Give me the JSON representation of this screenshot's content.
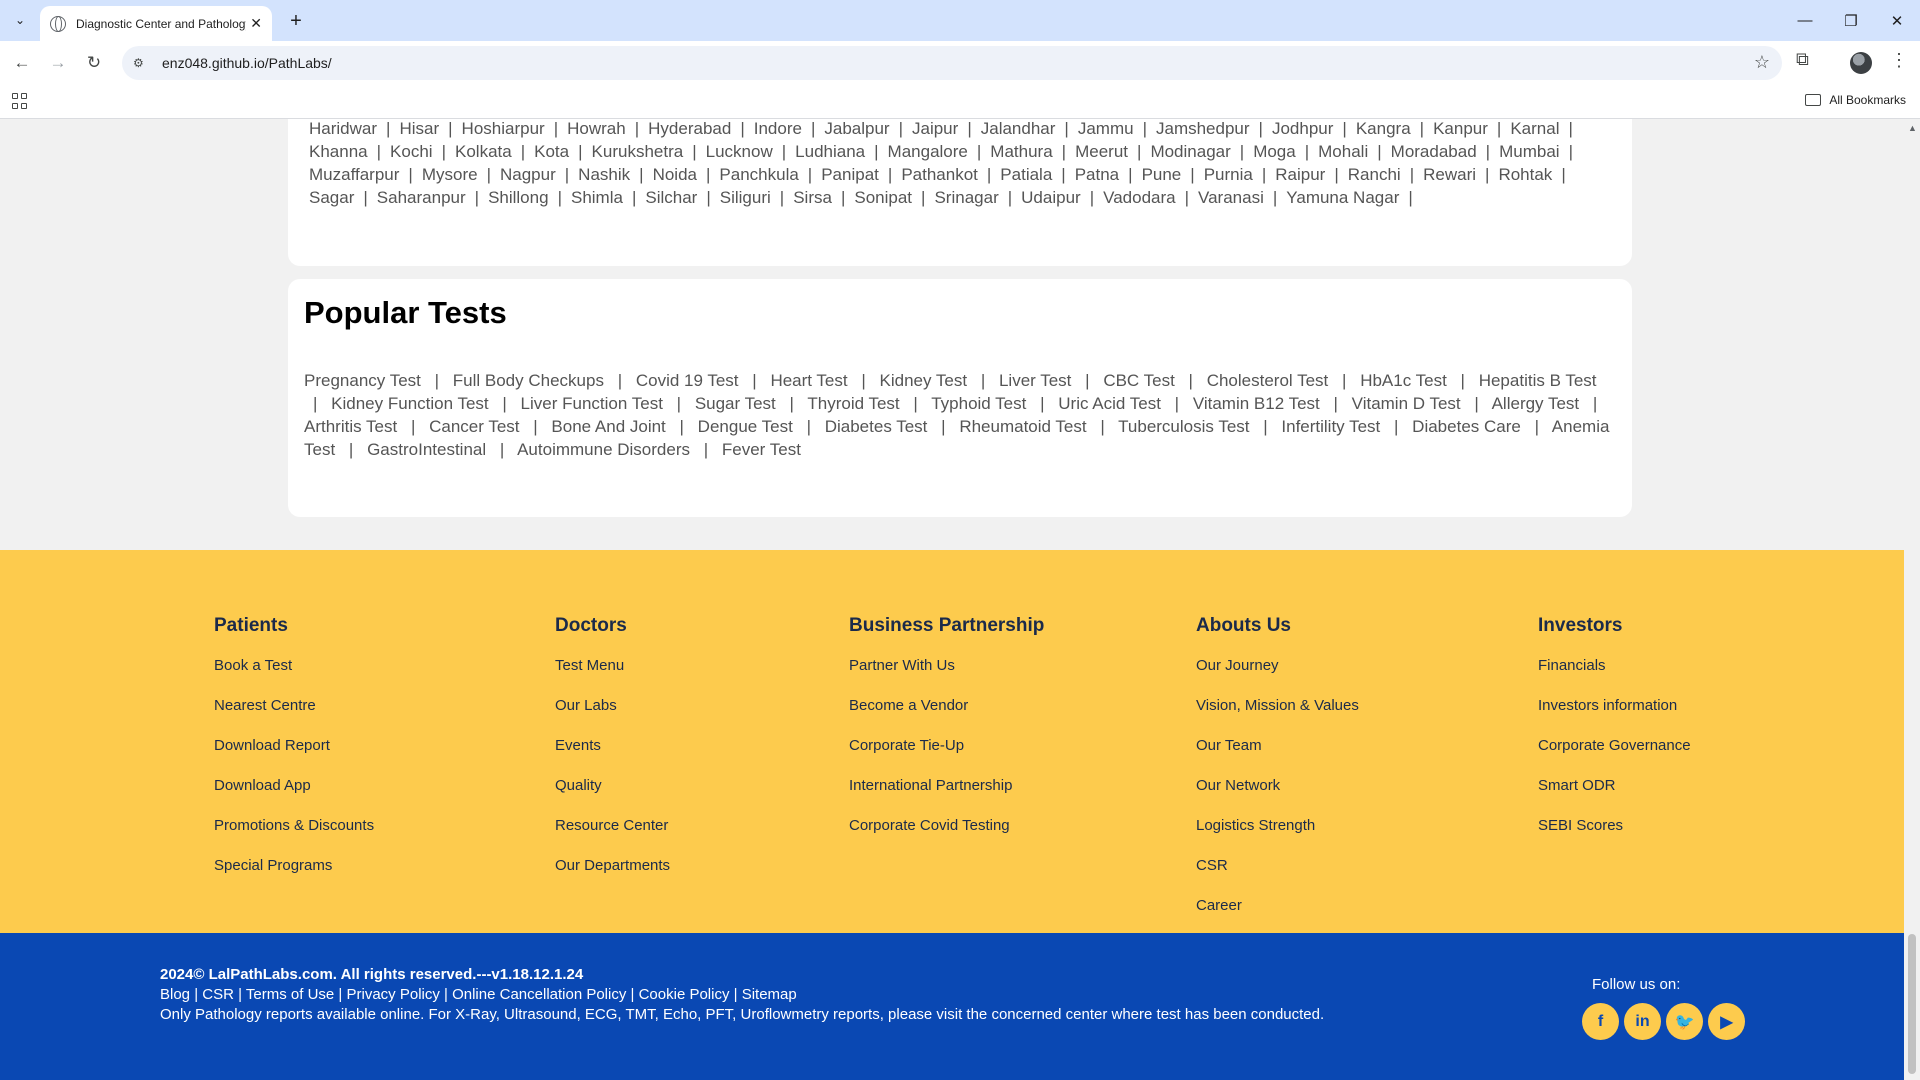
{
  "browser": {
    "tab_title": "Diagnostic Center and Pathology Lab",
    "url": "enz048.github.io/PathLabs/",
    "all_bookmarks": "All Bookmarks"
  },
  "cities": {
    "rows": [
      [
        "Haridwar",
        "Hisar",
        "Hoshiarpur",
        "Howrah",
        "Hyderabad",
        "Indore",
        "Jabalpur",
        "Jaipur",
        "Jalandhar",
        "Jammu",
        "Jamshedpur",
        "Jodhpur",
        "Kangra",
        "Kanpur",
        "Karnal"
      ],
      [
        "Khanna",
        "Kochi",
        "Kolkata",
        "Kota",
        "Kurukshetra",
        "Lucknow",
        "Ludhiana",
        "Mangalore",
        "Mathura",
        "Meerut",
        "Modinagar",
        "Moga",
        "Mohali",
        "Moradabad",
        "Mumbai"
      ],
      [
        "Muzaffarpur",
        "Mysore",
        "Nagpur",
        "Nashik",
        "Noida",
        "Panchkula",
        "Panipat",
        "Pathankot",
        "Patiala",
        "Patna",
        "Pune",
        "Purnia",
        "Raipur",
        "Ranchi",
        "Rewari",
        "Rohtak"
      ],
      [
        "Sagar",
        "Saharanpur",
        "Shillong",
        "Shimla",
        "Silchar",
        "Siliguri",
        "Sirsa",
        "Sonipat",
        "Srinagar",
        "Udaipur",
        "Vadodara",
        "Varanasi",
        "Yamuna Nagar"
      ]
    ]
  },
  "popular_tests": {
    "heading": "Popular Tests",
    "items": [
      "Pregnancy Test",
      "Full Body Checkups",
      "Covid 19 Test",
      "Heart Test",
      "Kidney Test",
      "Liver Test",
      "CBC Test",
      "Cholesterol Test",
      "HbA1c Test",
      "Hepatitis B Test",
      "Kidney Function Test",
      "Liver Function Test",
      "Sugar Test",
      "Thyroid Test",
      "Typhoid Test",
      "Uric Acid Test",
      "Vitamin B12 Test",
      "Vitamin D Test",
      "Allergy Test",
      "Arthritis Test",
      "Cancer Test",
      "Bone And Joint",
      "Dengue Test",
      "Diabetes Test",
      "Rheumatoid Test",
      "Tuberculosis Test",
      "Infertility Test",
      "Diabetes Care",
      "Anemia Test",
      "GastroIntestinal",
      "Autoimmune Disorders",
      "Fever Test"
    ]
  },
  "footer": {
    "columns": [
      {
        "heading": "Patients",
        "items": [
          "Book a Test",
          "Nearest Centre",
          "Download Report",
          "Download App",
          "Promotions & Discounts",
          "Special Programs"
        ]
      },
      {
        "heading": "Doctors",
        "items": [
          "Test Menu",
          "Our Labs",
          "Events",
          "Quality",
          "Resource Center",
          "Our Departments"
        ]
      },
      {
        "heading": "Business Partnership",
        "items": [
          "Partner With Us",
          "Become a Vendor",
          "Corporate Tie-Up",
          "International Partnership",
          "Corporate Covid Testing"
        ]
      },
      {
        "heading": "Abouts Us",
        "items": [
          "Our Journey",
          "Vision, Mission & Values",
          "Our Team",
          "Our Network",
          "Logistics Strength",
          "CSR",
          "Career"
        ]
      },
      {
        "heading": "Investors",
        "items": [
          "Financials",
          "Investors information",
          "Corporate Governance",
          "Smart ODR",
          "SEBI Scores"
        ]
      }
    ],
    "copyright": "2024© LalPathLabs.com. All rights reserved.---v1.18.12.1.24",
    "legal_links": [
      "Blog",
      "CSR",
      "Terms of Use",
      "Privacy Policy",
      "Online Cancellation Policy",
      "Cookie Policy",
      "Sitemap"
    ],
    "note": "Only Pathology reports available online. For X-Ray, Ultrasound, ECG, TMT, Echo, PFT, Uroflowmetry reports, please visit the concerned center where test has been conducted.",
    "follow_label": "Follow us on:",
    "socials": [
      {
        "name": "facebook-icon",
        "glyph": "f"
      },
      {
        "name": "linkedin-icon",
        "glyph": "in"
      },
      {
        "name": "twitter-icon",
        "glyph": "🐦"
      },
      {
        "name": "youtube-icon",
        "glyph": "▶"
      }
    ]
  },
  "colors": {
    "footer_yellow": "#fdcb4d",
    "footer_blue": "#0a48b3"
  }
}
